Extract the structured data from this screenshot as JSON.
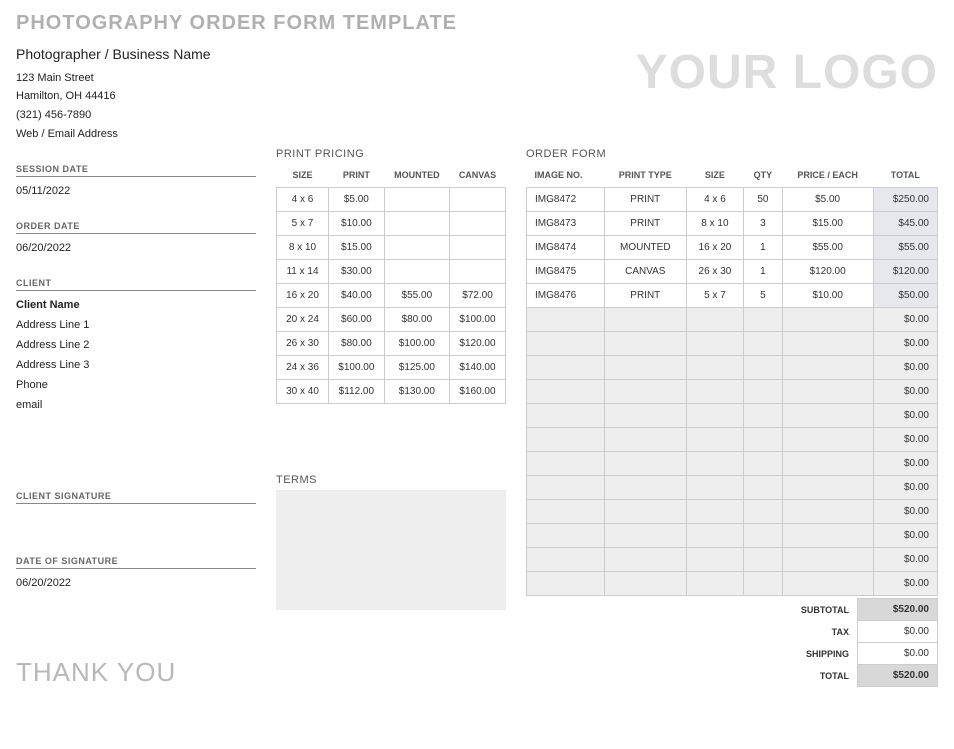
{
  "title": "PHOTOGRAPHY ORDER FORM TEMPLATE",
  "logo_text": "YOUR LOGO",
  "business": {
    "name": "Photographer / Business Name",
    "street": "123 Main Street",
    "city_line": "Hamilton, OH 44416",
    "phone": "(321) 456-7890",
    "web": "Web / Email Address"
  },
  "side": {
    "session_date_label": "SESSION DATE",
    "session_date": "05/11/2022",
    "order_date_label": "ORDER DATE",
    "order_date": "06/20/2022",
    "client_label": "CLIENT",
    "client_name": "Client Name",
    "addr1": "Address Line 1",
    "addr2": "Address Line 2",
    "addr3": "Address Line 3",
    "phone": "Phone",
    "email": "email",
    "sig_label": "CLIENT SIGNATURE",
    "sig_date_label": "DATE OF SIGNATURE",
    "sig_date": "06/20/2022"
  },
  "pricing": {
    "title": "PRINT PRICING",
    "cols": {
      "size": "SIZE",
      "print": "PRINT",
      "mounted": "MOUNTED",
      "canvas": "CANVAS"
    },
    "rows": [
      {
        "size": "4 x 6",
        "print": "$5.00",
        "mounted": "",
        "canvas": ""
      },
      {
        "size": "5 x 7",
        "print": "$10.00",
        "mounted": "",
        "canvas": ""
      },
      {
        "size": "8 x 10",
        "print": "$15.00",
        "mounted": "",
        "canvas": ""
      },
      {
        "size": "11 x 14",
        "print": "$30.00",
        "mounted": "",
        "canvas": ""
      },
      {
        "size": "16 x 20",
        "print": "$40.00",
        "mounted": "$55.00",
        "canvas": "$72.00"
      },
      {
        "size": "20 x 24",
        "print": "$60.00",
        "mounted": "$80.00",
        "canvas": "$100.00"
      },
      {
        "size": "26 x 30",
        "print": "$80.00",
        "mounted": "$100.00",
        "canvas": "$120.00"
      },
      {
        "size": "24 x 36",
        "print": "$100.00",
        "mounted": "$125.00",
        "canvas": "$140.00"
      },
      {
        "size": "30 x 40",
        "print": "$112.00",
        "mounted": "$130.00",
        "canvas": "$160.00"
      }
    ]
  },
  "terms_title": "TERMS",
  "order": {
    "title": "ORDER FORM",
    "cols": {
      "img": "IMAGE NO.",
      "type": "PRINT TYPE",
      "size": "SIZE",
      "qty": "QTY",
      "price": "PRICE / EACH",
      "total": "TOTAL"
    },
    "rows": [
      {
        "img": "IMG8472",
        "type": "PRINT",
        "size": "4 x 6",
        "qty": "50",
        "price": "$5.00",
        "total": "$250.00"
      },
      {
        "img": "IMG8473",
        "type": "PRINT",
        "size": "8 x 10",
        "qty": "3",
        "price": "$15.00",
        "total": "$45.00"
      },
      {
        "img": "IMG8474",
        "type": "MOUNTED",
        "size": "16 x 20",
        "qty": "1",
        "price": "$55.00",
        "total": "$55.00"
      },
      {
        "img": "IMG8475",
        "type": "CANVAS",
        "size": "26 x 30",
        "qty": "1",
        "price": "$120.00",
        "total": "$120.00"
      },
      {
        "img": "IMG8476",
        "type": "PRINT",
        "size": "5 x 7",
        "qty": "5",
        "price": "$10.00",
        "total": "$50.00"
      }
    ],
    "empty_total": "$0.00",
    "empty_rows": 12
  },
  "summary": {
    "subtotal_label": "SUBTOTAL",
    "subtotal": "$520.00",
    "tax_label": "TAX",
    "tax": "$0.00",
    "ship_label": "SHIPPING",
    "ship": "$0.00",
    "total_label": "TOTAL",
    "total": "$520.00"
  },
  "thanks": "THANK YOU"
}
